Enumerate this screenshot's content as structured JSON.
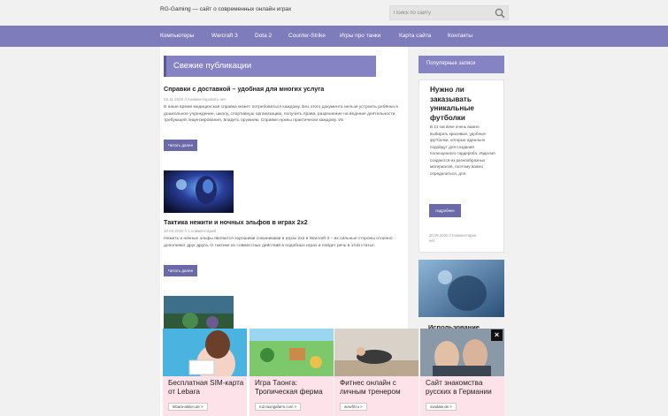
{
  "header": {
    "site_title": "RG-Gaming — сайт о современных онлайн играх",
    "search_placeholder": "Поиск по сайту"
  },
  "nav": {
    "items": [
      "Компьютеры",
      "Warcraft 3",
      "Dota 2",
      "Counter-Strike",
      "Игры про танки",
      "Карта сайта",
      "Контакты"
    ]
  },
  "main": {
    "section_title": "Свежие публикации",
    "posts": [
      {
        "title": "Справки с доставкой – удобная для многих услуга",
        "meta": "03.11.2020 // Комментировать нет",
        "excerpt": "В наше время медицинская справка может потребоваться каждому. Без этого документа нельзя устроить ребёнка в дошкольное учреждение, школу, спортивную организацию, получить права, разрешение на ведение деятельности, требующей лицензирования, владеть оружием. Справки нужны практически каждому. Их",
        "read_more": "Читать далее"
      },
      {
        "title": "Тактика нежити и ночных эльфов в играх 2x2",
        "meta": "30.04.2020 // 1 комментарий",
        "excerpt": "Нежить и ночные эльфы являются хорошими союзниками в играх 2x2 в Warcraft 3 – их сильные стороны отлично дополняют друг друга. О тактике их совместных действий в подобных играх и пойдет речь в этой статье.",
        "read_more": "Читать далее"
      }
    ]
  },
  "sidebar": {
    "title": "Популярные записи",
    "widget": {
      "title": "Нужно ли заказывать уникальные футболки",
      "text": "В 21-ом веке очень важно выбирать красивые, удобные футболки, которые идеально подойдут для создания полноценного гардероба. Изделия создаются из разнообразных материалов, поэтому важно определиться, для",
      "button": "подробнее",
      "meta": "30.09.2020 // Комментарии нет"
    },
    "second_title": "Использование"
  },
  "ads": {
    "label": "",
    "cards": [
      {
        "title": "Бесплатная SIM-карта от Lebara",
        "link": "lebara-aktion.de >"
      },
      {
        "title": "Игра Таонга: Тропическая ферма",
        "link": "ru2.taongafarm.com >"
      },
      {
        "title": "Фитнес онлайн с личным тренером",
        "link": "wowfit.ru >"
      },
      {
        "title": "Сайт знакомства русских в Германии",
        "link": "svadate.de >"
      }
    ],
    "close": "×"
  },
  "colors": {
    "nav_bg": "#7e7cba",
    "section_head_bg": "#8583c4",
    "button_bg": "#6b69a8",
    "ad_bg": "#fde2ea"
  }
}
